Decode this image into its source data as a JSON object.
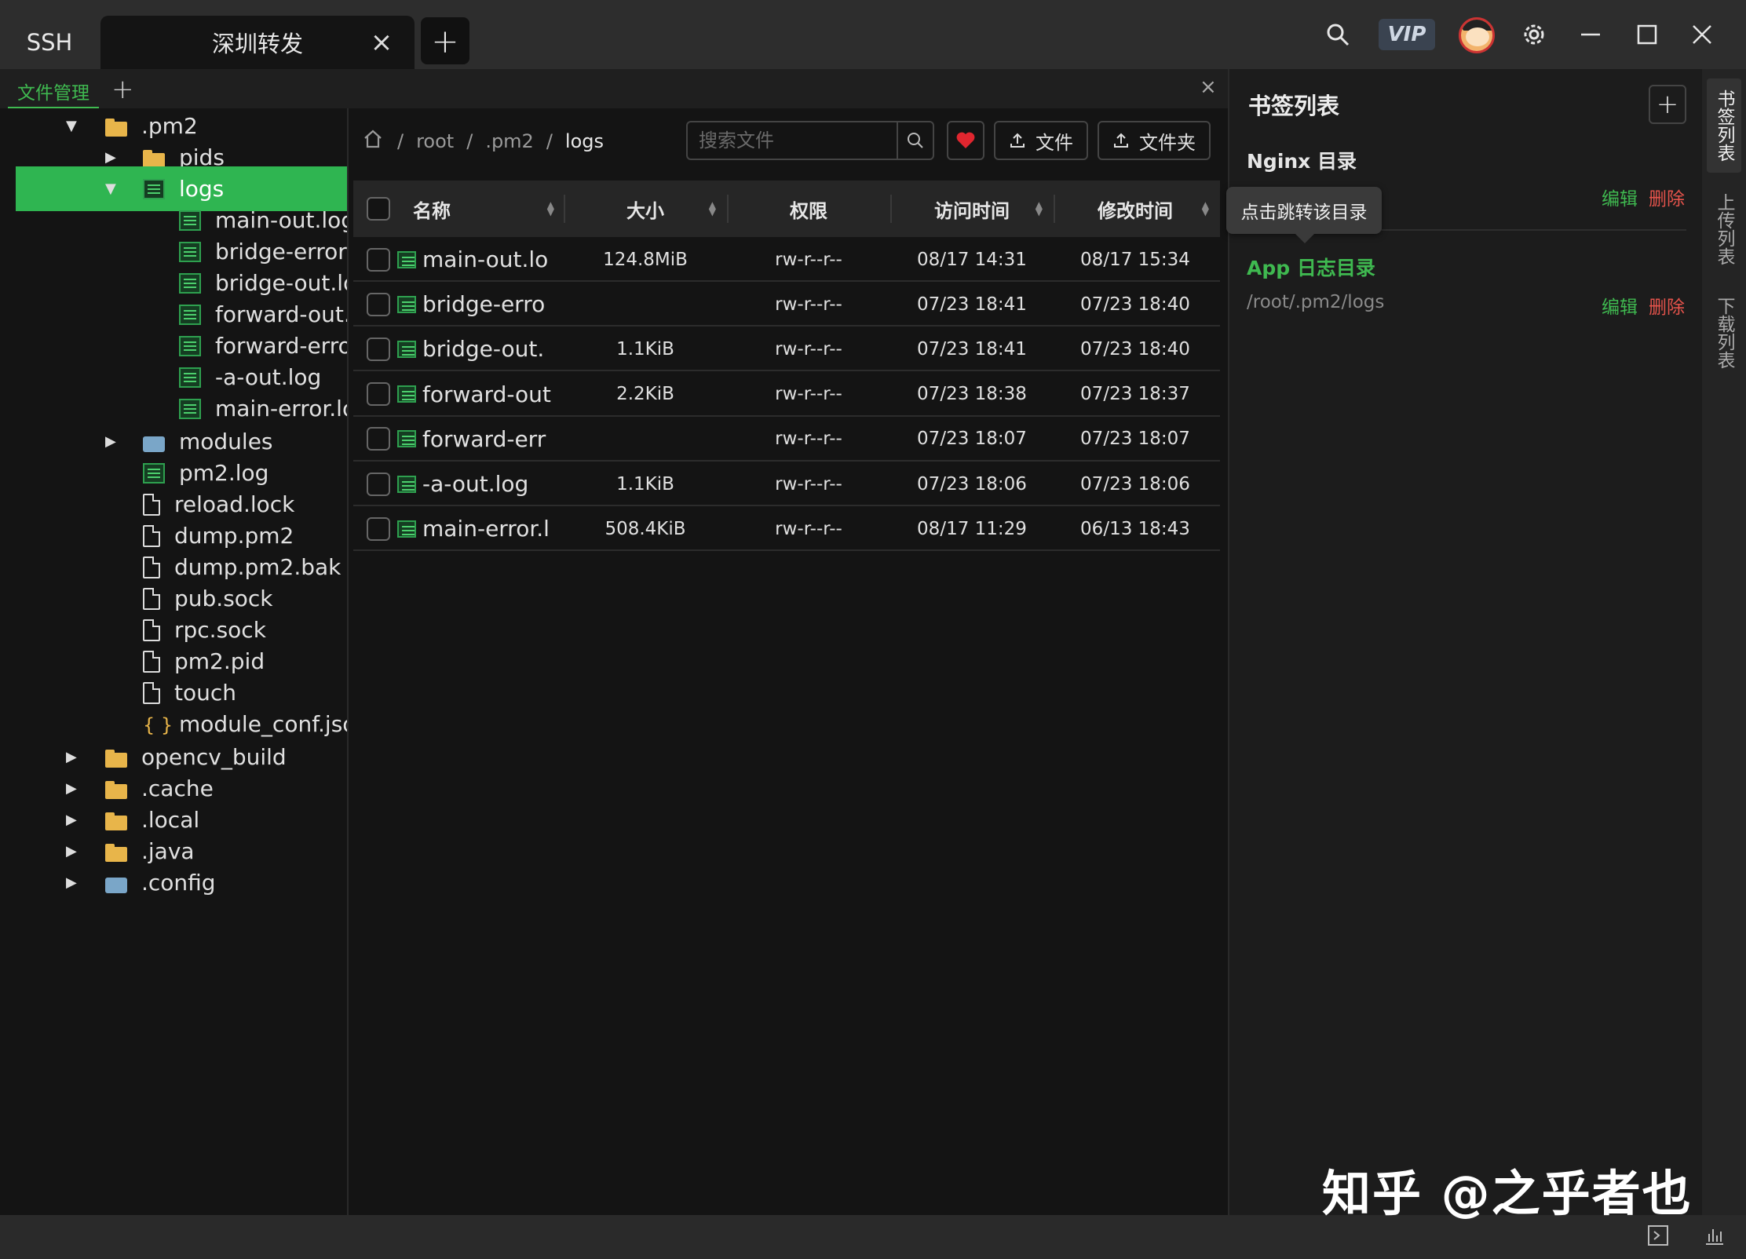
{
  "titlebar": {
    "ssh_tab": "SSH",
    "session_tab": "深圳转发",
    "vip": "VIP"
  },
  "subtabs": {
    "file_manager": "文件管理"
  },
  "tree": {
    "items": [
      {
        "label": ".pm2",
        "type": "folder"
      },
      {
        "label": "pids",
        "type": "folder"
      },
      {
        "label": "logs",
        "type": "folder-log"
      },
      {
        "label": "main-out.log",
        "type": "log"
      },
      {
        "label": "bridge-error.",
        "type": "log"
      },
      {
        "label": "bridge-out.lo",
        "type": "log"
      },
      {
        "label": "forward-out.l",
        "type": "log"
      },
      {
        "label": "forward-erro",
        "type": "log"
      },
      {
        "label": "-a-out.log",
        "type": "log"
      },
      {
        "label": "main-error.lo",
        "type": "log"
      },
      {
        "label": "modules",
        "type": "modules"
      },
      {
        "label": "pm2.log",
        "type": "log"
      },
      {
        "label": "reload.lock",
        "type": "file"
      },
      {
        "label": "dump.pm2",
        "type": "file"
      },
      {
        "label": "dump.pm2.bak",
        "type": "file"
      },
      {
        "label": "pub.sock",
        "type": "file"
      },
      {
        "label": "rpc.sock",
        "type": "file"
      },
      {
        "label": "pm2.pid",
        "type": "file"
      },
      {
        "label": "touch",
        "type": "file"
      },
      {
        "label": "module_conf.jso",
        "type": "json"
      },
      {
        "label": "opencv_build",
        "type": "folder"
      },
      {
        "label": ".cache",
        "type": "folder"
      },
      {
        "label": ".local",
        "type": "folder"
      },
      {
        "label": ".java",
        "type": "folder"
      },
      {
        "label": ".config",
        "type": "config"
      }
    ]
  },
  "breadcrumb": {
    "sep": "/",
    "items": [
      "root",
      ".pm2",
      "logs"
    ]
  },
  "toolbar": {
    "search_placeholder": "搜索文件",
    "upload_file": "文件",
    "upload_folder": "文件夹"
  },
  "table": {
    "headers": {
      "name": "名称",
      "size": "大小",
      "perm": "权限",
      "atime": "访问时间",
      "mtime": "修改时间"
    },
    "rows": [
      {
        "name": "main-out.lo",
        "size": "124.8MiB",
        "perm": "rw-r--r--",
        "atime": "08/17 14:31",
        "mtime": "08/17 15:34"
      },
      {
        "name": "bridge-erro",
        "size": "",
        "perm": "rw-r--r--",
        "atime": "07/23 18:41",
        "mtime": "07/23 18:40"
      },
      {
        "name": "bridge-out.",
        "size": "1.1KiB",
        "perm": "rw-r--r--",
        "atime": "07/23 18:41",
        "mtime": "07/23 18:40"
      },
      {
        "name": "forward-out",
        "size": "2.2KiB",
        "perm": "rw-r--r--",
        "atime": "07/23 18:38",
        "mtime": "07/23 18:37"
      },
      {
        "name": "forward-err",
        "size": "",
        "perm": "rw-r--r--",
        "atime": "07/23 18:07",
        "mtime": "07/23 18:07"
      },
      {
        "name": "-a-out.log",
        "size": "1.1KiB",
        "perm": "rw-r--r--",
        "atime": "07/23 18:06",
        "mtime": "07/23 18:06"
      },
      {
        "name": "main-error.l",
        "size": "508.4KiB",
        "perm": "rw-r--r--",
        "atime": "08/17 11:29",
        "mtime": "06/13 18:43"
      }
    ]
  },
  "bookmarks": {
    "title": "书签列表",
    "tooltip": "点击跳转该目录",
    "edit": "编辑",
    "delete": "删除",
    "items": [
      {
        "name": "Nginx 目录",
        "path": ""
      },
      {
        "name": "App 日志目录",
        "path": "/root/.pm2/logs"
      }
    ]
  },
  "side_tabs": [
    "书签列表",
    "上传列表",
    "下载列表"
  ],
  "watermark": "知乎 @之乎者也",
  "colors": {
    "accent": "#3fb950",
    "danger": "#e5534b",
    "folder": "#e8b54a"
  }
}
